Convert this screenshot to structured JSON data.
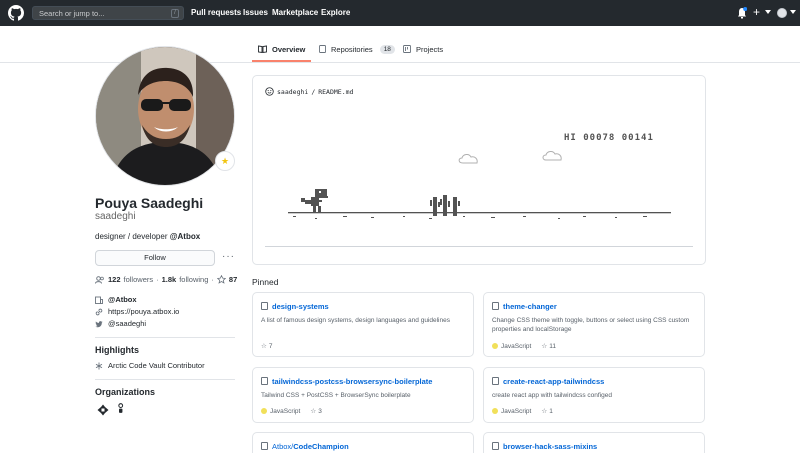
{
  "header": {
    "search_placeholder": "Search or jump to...",
    "search_shortcut": "/",
    "nav": [
      "Pull requests",
      "Issues",
      "Marketplace",
      "Explore"
    ],
    "plus_icon": "+"
  },
  "tabs": [
    {
      "label": "Overview",
      "active": true
    },
    {
      "label": "Repositories",
      "count": "18"
    },
    {
      "label": "Projects"
    }
  ],
  "profile": {
    "name": "Pouya Saadeghi",
    "login": "saadeghi",
    "bio_prefix": "designer / developer ",
    "bio_org": "@Atbox",
    "status_emoji": "★",
    "follow_label": "Follow",
    "more_label": "···",
    "followers_count": "122",
    "followers_label": "followers",
    "following_count": "1.8k",
    "following_label": "following",
    "stars_count": "87",
    "company": "@Atbox",
    "website": "https://pouya.atbox.io",
    "twitter": "@saadeghi"
  },
  "highlights": {
    "heading": "Highlights",
    "items": [
      "Arctic Code Vault Contributor"
    ]
  },
  "organizations": {
    "heading": "Organizations"
  },
  "readme": {
    "owner": "saadeghi",
    "separator": "/",
    "file": "README.md",
    "score": "HI 00078 00141"
  },
  "pinned": {
    "heading": "Pinned",
    "cards": [
      {
        "owner": "",
        "name": "design-systems",
        "desc": "A list of famous design systems, design languages and guidelines",
        "language": "",
        "stars": "7"
      },
      {
        "owner": "",
        "name": "theme-changer",
        "desc": "Change CSS theme with toggle, buttons or select using CSS custom properties and localStorage",
        "language": "JavaScript",
        "stars": "11"
      },
      {
        "owner": "",
        "name": "tailwindcss-postcss-browsersync-boilerplate",
        "desc": "Tailwind CSS + PostCSS + BrowserSync boilerplate",
        "language": "JavaScript",
        "stars": "3"
      },
      {
        "owner": "",
        "name": "create-react-app-tailwindcss",
        "desc": "create react app with tailwindcss configed",
        "language": "JavaScript",
        "stars": "1"
      },
      {
        "owner": "Atbox/",
        "name": "CodeChampion",
        "desc": "",
        "language": "",
        "stars": ""
      },
      {
        "owner": "",
        "name": "browser-hack-sass-mixins",
        "desc": "",
        "language": "",
        "stars": ""
      }
    ]
  },
  "colors": {
    "header_bg": "#24292e",
    "link": "#0366d6",
    "active_tab": "#f9826c",
    "javascript": "#f1e05a"
  }
}
